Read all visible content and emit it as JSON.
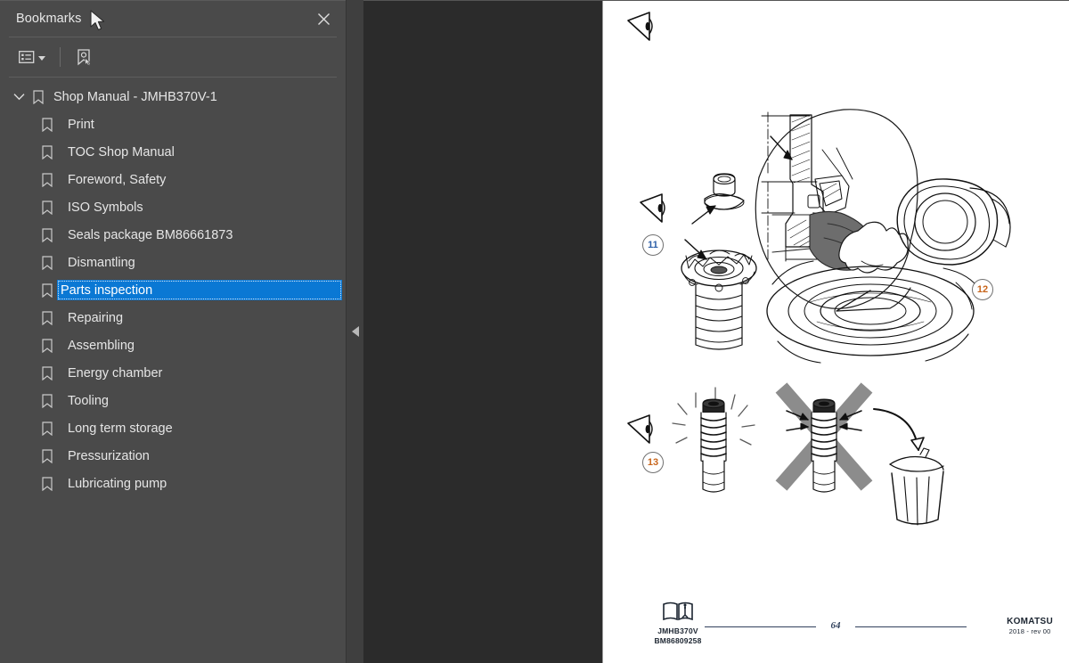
{
  "panel": {
    "title": "Bookmarks",
    "close_icon": "close-icon",
    "toolbar": {
      "options_label": "list-options-icon",
      "new_bookmark_label": "new-bookmark-icon"
    }
  },
  "bookmarks": {
    "root": {
      "label": "Shop Manual - JMHB370V-1",
      "expanded": true
    },
    "items": [
      {
        "label": "Print",
        "selected": false
      },
      {
        "label": "TOC Shop Manual",
        "selected": false
      },
      {
        "label": "Foreword, Safety",
        "selected": false
      },
      {
        "label": "ISO Symbols",
        "selected": false
      },
      {
        "label": "Seals package BM86661873",
        "selected": false
      },
      {
        "label": "Dismantling",
        "selected": false
      },
      {
        "label": "Parts inspection",
        "selected": true
      },
      {
        "label": "Repairing",
        "selected": false
      },
      {
        "label": "Assembling",
        "selected": false
      },
      {
        "label": "Energy chamber",
        "selected": false
      },
      {
        "label": "Tooling",
        "selected": false
      },
      {
        "label": "Long term storage",
        "selected": false
      },
      {
        "label": "Pressurization",
        "selected": false
      },
      {
        "label": "Lubricating pump",
        "selected": false
      }
    ]
  },
  "splitter": {
    "collapse_icon": "collapse-left-icon"
  },
  "document": {
    "steps": [
      {
        "number": "11",
        "view_icon": "view-direction-eye-icon"
      },
      {
        "number": "12",
        "view_icon": "view-direction-eye-icon"
      },
      {
        "number": "13",
        "view_icon": "view-direction-eye-icon"
      }
    ],
    "footer": {
      "model_code": "JMHB370V",
      "part_code": "BM86809258",
      "page_number": "64",
      "brand": "KOMATSU",
      "revision": "2018 -  rev 00"
    }
  },
  "colors": {
    "sidebar_bg": "#4a4a4a",
    "viewer_bg": "#2b2b2b",
    "selection_blue": "#0a78d4",
    "page_white": "#ffffff"
  }
}
